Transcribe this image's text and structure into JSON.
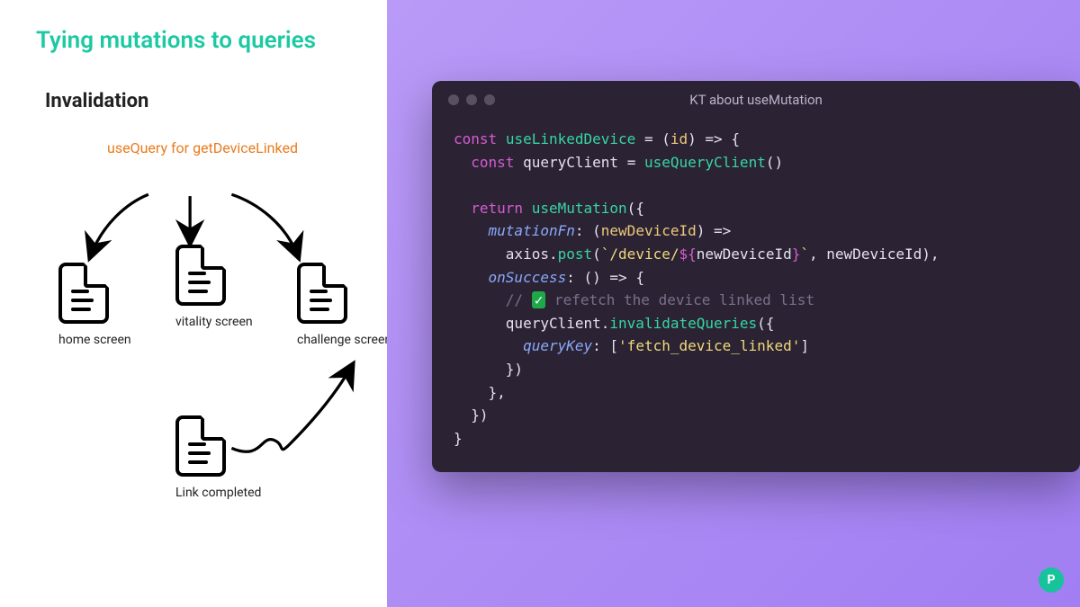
{
  "title": "Tying mutations to queries",
  "subtitle": "Invalidation",
  "diagram": {
    "queryLabel": "useQuery for getDeviceLinked",
    "nodes": {
      "home": "home screen",
      "vitality": "vitality screen",
      "challenge": "challenge screen",
      "link": "Link completed"
    }
  },
  "codeWindow": {
    "title": "KT about useMutation",
    "tokens": {
      "const": "const",
      "return": "return",
      "useLinkedDevice": "useLinkedDevice",
      "id": "id",
      "queryClient": "queryClient",
      "useQueryClient": "useQueryClient",
      "useMutation": "useMutation",
      "mutationFn": "mutationFn",
      "newDeviceId": "newDeviceId",
      "axios": "axios",
      "post": "post",
      "urlPrefix": "`/device/",
      "urlInterpStart": "${",
      "urlInterpEnd": "}",
      "urlSuffix": "`",
      "onSuccess": "onSuccess",
      "commentCheck": "✓",
      "commentText": " refetch the device linked list",
      "invalidateQueries": "invalidateQueries",
      "queryKey": "queryKey",
      "queryKeyValue": "'fetch_device_linked'"
    }
  },
  "brand": "P"
}
